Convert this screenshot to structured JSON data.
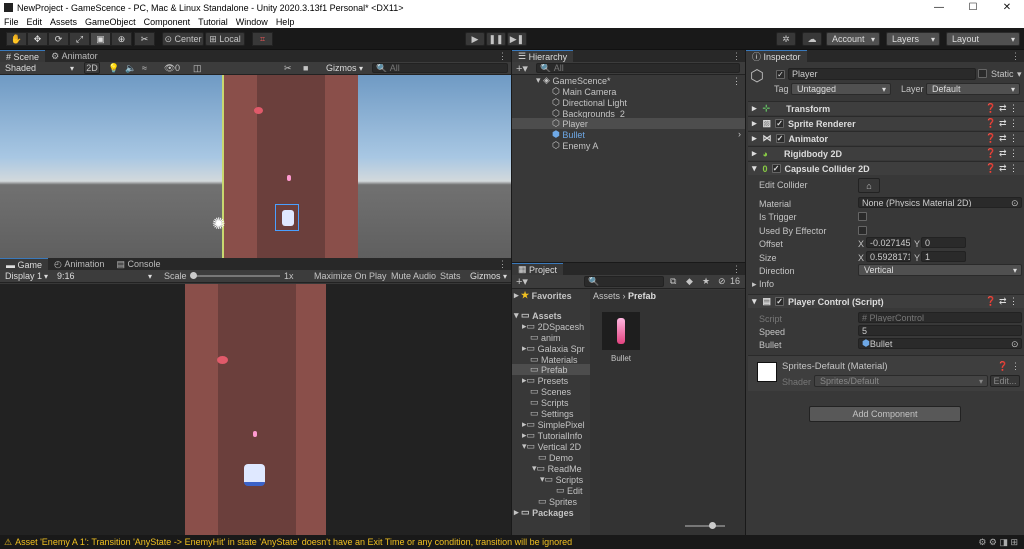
{
  "window": {
    "title": "NewProject - GameScence - PC, Mac & Linux Standalone - Unity 2020.3.13f1 Personal* <DX11>",
    "minimize": "—",
    "maximize": "☐",
    "close": "✕"
  },
  "menu": [
    "File",
    "Edit",
    "Assets",
    "GameObject",
    "Component",
    "Tutorial",
    "Window",
    "Help"
  ],
  "toolbar": {
    "center": "Center",
    "local": "Local",
    "account": "Account",
    "layers": "Layers",
    "layout": "Layout",
    "tools": [
      "hand-tool-icon",
      "move-tool-icon",
      "rotate-tool-icon",
      "scale-tool-icon",
      "rect-tool-icon",
      "transform-tool-icon",
      "custom-tool-icon"
    ]
  },
  "scene": {
    "tabs": [
      "Scene",
      "Animator"
    ],
    "shading": "Shaded",
    "mode2d": "2D",
    "gizmos": "Gizmos",
    "search_placeholder": "All",
    "fx_count": "0"
  },
  "game": {
    "tabs": [
      "Game",
      "Animation",
      "Console"
    ],
    "display": "Display 1",
    "aspect": "9:16",
    "scale_label": "Scale",
    "scale_value": "1x",
    "buttons": [
      "Maximize On Play",
      "Mute Audio",
      "Stats",
      "Gizmos"
    ]
  },
  "hierarchy": {
    "title": "Hierarchy",
    "search_placeholder": "All",
    "scene_name": "GameScence*",
    "items": [
      "Main Camera",
      "Directional Light",
      "Backgrounds_2",
      "Player",
      "Bullet",
      "Enemy A"
    ]
  },
  "project": {
    "title": "Project",
    "favorites": "Favorites",
    "assets_root": "Assets",
    "breadcrumb": [
      "Assets",
      "Prefab"
    ],
    "count": "16",
    "tree": [
      "2DSpacesh",
      "anim",
      "Galaxia Spr",
      "Materials",
      "Prefab",
      "Presets",
      "Scenes",
      "Scripts",
      "Settings",
      "SimplePixel",
      "TutorialInfo",
      "Vertical 2D",
      "Demo",
      "ReadMe",
      "Scripts",
      "Edit",
      "Sprites",
      "Packages"
    ],
    "asset_item": "Bullet"
  },
  "inspector": {
    "title": "Inspector",
    "object_name": "Player",
    "static_label": "Static",
    "tag_label": "Tag",
    "tag_value": "Untagged",
    "layer_label": "Layer",
    "layer_value": "Default",
    "components": [
      "Transform",
      "Sprite Renderer",
      "Animator",
      "Rigidbody 2D",
      "Capsule Collider 2D",
      "Player Control (Script)"
    ],
    "collider": {
      "edit_collider": "Edit Collider",
      "material_label": "Material",
      "material_value": "None (Physics Material 2D)",
      "is_trigger": "Is Trigger",
      "used_by_effector": "Used By Effector",
      "offset_label": "Offset",
      "offset_x": "-0.027145",
      "offset_y": "0",
      "size_label": "Size",
      "size_x": "0.5928171",
      "size_y": "1",
      "direction_label": "Direction",
      "direction_value": "Vertical",
      "info": "Info",
      "x": "X",
      "y": "Y"
    },
    "script": {
      "script_label": "Script",
      "script_value": "PlayerControl",
      "speed_label": "Speed",
      "speed_value": "5",
      "bullet_label": "Bullet",
      "bullet_value": "Bullet"
    },
    "material": {
      "name": "Sprites-Default (Material)",
      "shader_label": "Shader",
      "shader_value": "Sprites/Default",
      "edit": "Edit..."
    },
    "add_component": "Add Component"
  },
  "status": {
    "message": "Asset 'Enemy A 1': Transition 'AnyState -> EnemyHit' in state 'AnyState' doesn't have an Exit Time or any condition, transition will be ignored"
  },
  "colors": {
    "accent": "#3a79bb",
    "selection": "#2c5d87",
    "warning": "#f0c020",
    "road": "#6b3f3c",
    "sky": "#8ab6e0",
    "ground": "#6d6d6d"
  }
}
